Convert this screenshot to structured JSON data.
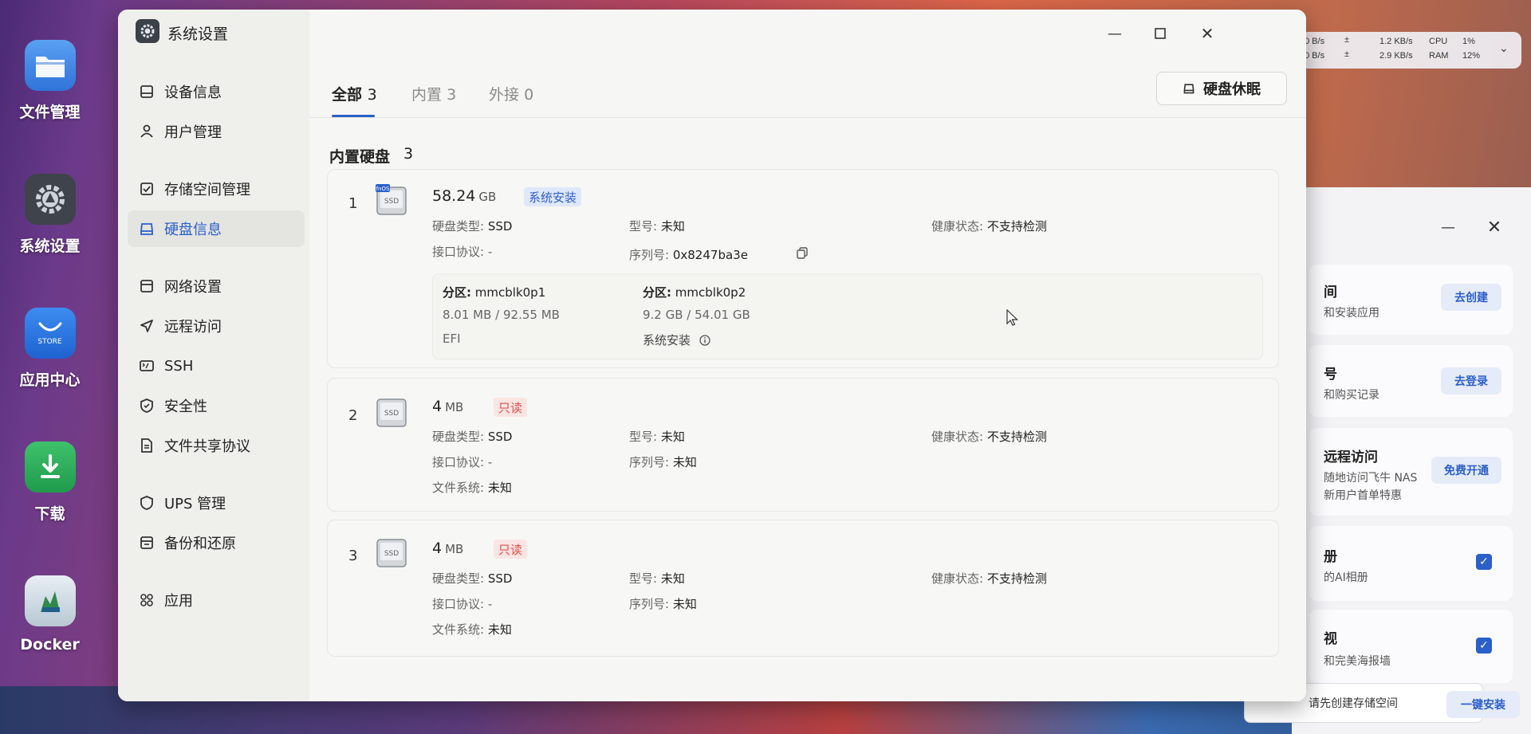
{
  "dock": [
    {
      "label": "文件管理",
      "icon": "folder-icon"
    },
    {
      "label": "系统设置",
      "icon": "settings-icon"
    },
    {
      "label": "应用中心",
      "icon": "store-icon",
      "badge_text": "STORE"
    },
    {
      "label": "下载",
      "icon": "download-icon"
    },
    {
      "label": "Docker",
      "icon": "docker-icon"
    }
  ],
  "status": {
    "up_rate": "0 B/s",
    "down_rate": "0 B/s",
    "net_up": "1.2 KB/s",
    "net_down": "2.9 KB/s",
    "cpu_label": "CPU",
    "cpu_value": "1%",
    "ram_label": "RAM",
    "ram_value": "12%"
  },
  "side_panel": {
    "cards": [
      {
        "title": "间",
        "desc": "和安装应用",
        "button": "去创建"
      },
      {
        "title": "号",
        "desc": "和购买记录",
        "button": "去登录"
      },
      {
        "title": "远程访问",
        "desc": "随地访问飞牛 NAS",
        "desc2": "新用户首单特惠",
        "button": "免费开通"
      },
      {
        "title": "册",
        "desc": "的AI相册",
        "checked": true
      },
      {
        "title": "视",
        "desc": "和完美海报墙",
        "checked": true
      }
    ],
    "bottom_select": "请先创建存储空间",
    "bottom_button": "一键安装"
  },
  "window": {
    "title": "系统设置",
    "nav": [
      {
        "label": "设备信息",
        "icon": "device-info-icon"
      },
      {
        "label": "用户管理",
        "icon": "user-icon"
      },
      {
        "label": "存储空间管理",
        "icon": "storage-icon"
      },
      {
        "label": "硬盘信息",
        "icon": "disk-icon",
        "active": true
      },
      {
        "label": "网络设置",
        "icon": "network-icon"
      },
      {
        "label": "远程访问",
        "icon": "remote-access-icon"
      },
      {
        "label": "SSH",
        "icon": "ssh-icon"
      },
      {
        "label": "安全性",
        "icon": "shield-icon"
      },
      {
        "label": "文件共享协议",
        "icon": "file-share-icon"
      },
      {
        "label": "UPS 管理",
        "icon": "ups-icon"
      },
      {
        "label": "备份和还原",
        "icon": "backup-icon"
      },
      {
        "label": "应用",
        "icon": "apps-icon"
      }
    ],
    "tabs": [
      {
        "label": "全部",
        "count": "3",
        "active": true
      },
      {
        "label": "内置",
        "count": "3"
      },
      {
        "label": "外接",
        "count": "0"
      }
    ],
    "sleep_button": "硬盘休眠",
    "section_title": "内置硬盘",
    "section_count": "3",
    "labels": {
      "disk_type": "硬盘类型:",
      "model": "型号:",
      "health": "健康状态:",
      "interface": "接口协议:",
      "serial": "序列号:",
      "filesystem": "文件系统:",
      "partition": "分区:"
    },
    "disks": [
      {
        "index": "1",
        "size": "58.24",
        "unit": "GB",
        "badge": "系统安装",
        "badge_color": "blue",
        "img_tag": "fnOS",
        "disk_type": "SSD",
        "model": "未知",
        "health": "不支持检测",
        "interface": "-",
        "serial": "0x8247ba3e",
        "partitions": [
          {
            "name": "mmcblk0p1",
            "usage": "8.01 MB / 92.55 MB",
            "note": "EFI"
          },
          {
            "name": "mmcblk0p2",
            "usage": "9.2 GB / 54.01 GB",
            "note": "系统安装"
          }
        ]
      },
      {
        "index": "2",
        "size": "4",
        "unit": "MB",
        "badge": "只读",
        "badge_color": "red",
        "disk_type": "SSD",
        "model": "未知",
        "health": "不支持检测",
        "interface": "-",
        "serial": "未知",
        "filesystem": "未知"
      },
      {
        "index": "3",
        "size": "4",
        "unit": "MB",
        "badge": "只读",
        "badge_color": "red",
        "disk_type": "SSD",
        "model": "未知",
        "health": "不支持检测",
        "interface": "-",
        "serial": "未知",
        "filesystem": "未知"
      }
    ]
  },
  "colors": {
    "accent": "#2b5fc9",
    "readonly": "#e0524a"
  }
}
